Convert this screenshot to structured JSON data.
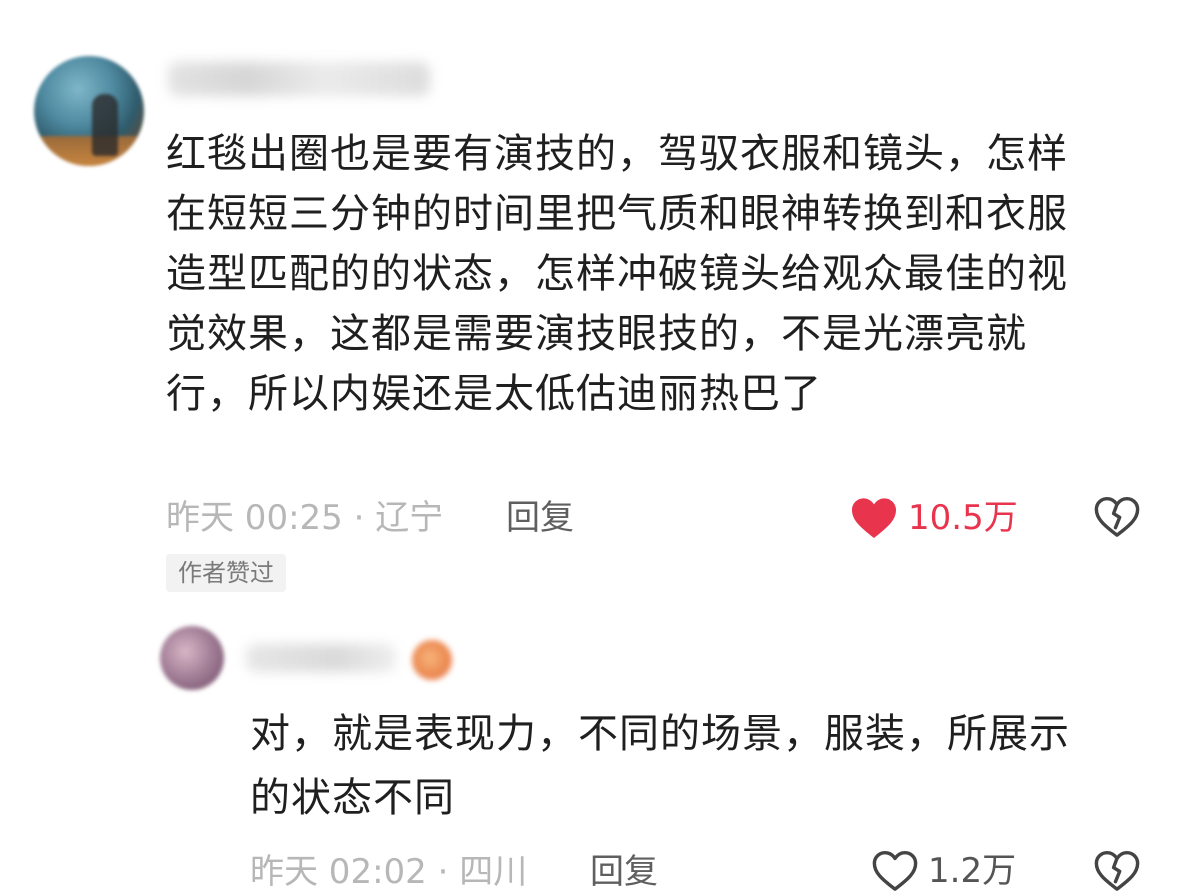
{
  "comment": {
    "text": "红毯出圈也是要有演技的，驾驭衣服和镜头，怎样\n在短短三分钟的时间里把气质和眼神转换到和衣服\n造型匹配的的状态，怎样冲破镜头给观众最佳的视\n觉效果，这都是需要演技眼技的，不是光漂亮就\n行，所以内娱还是太低估迪丽热巴了",
    "time_location": "昨天 00:25 · 辽宁",
    "reply_label": "回复",
    "like_count": "10.5万",
    "liked": true,
    "author_badge": "作者赞过",
    "colors": {
      "like_active": "#e8344d",
      "meta": "#b7b7b7"
    },
    "icons": {
      "like": "heart-filled-icon",
      "dislike": "broken-heart-icon"
    }
  },
  "reply": {
    "text": "对，就是表现力，不同的场景，服装，所展示\n的状态不同",
    "time_location": "昨天 02:02 · 四川",
    "reply_label": "回复",
    "like_count": "1.2万",
    "liked": false,
    "icons": {
      "like": "heart-outline-icon",
      "dislike": "broken-heart-icon"
    }
  }
}
